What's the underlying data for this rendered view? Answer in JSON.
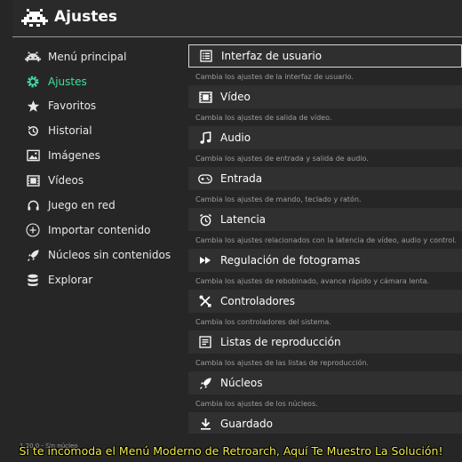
{
  "header": {
    "title": "Ajustes",
    "logo_icon": "retroarch-invader-icon"
  },
  "sidebar": {
    "items": [
      {
        "label": "Menú principal",
        "icon": "invader-icon",
        "active": false
      },
      {
        "label": "Ajustes",
        "icon": "gear-icon",
        "active": true
      },
      {
        "label": "Favoritos",
        "icon": "star-icon",
        "active": false
      },
      {
        "label": "Historial",
        "icon": "history-icon",
        "active": false
      },
      {
        "label": "Imágenes",
        "icon": "image-icon",
        "active": false
      },
      {
        "label": "Vídeos",
        "icon": "film-icon",
        "active": false
      },
      {
        "label": "Juego en red",
        "icon": "headset-icon",
        "active": false
      },
      {
        "label": "Importar contenido",
        "icon": "plus-circle-icon",
        "active": false
      },
      {
        "label": "Núcleos sin contenidos",
        "icon": "rocket-icon",
        "active": false
      },
      {
        "label": "Explorar",
        "icon": "database-icon",
        "active": false
      }
    ]
  },
  "settings": {
    "items": [
      {
        "label": "Interfaz de usuario",
        "desc": "Cambia los ajustes de la interfaz de usuario.",
        "icon": "menu-list-icon",
        "selected": true
      },
      {
        "label": "Vídeo",
        "desc": "Cambia los ajustes de salida de vídeo.",
        "icon": "film-icon",
        "selected": false
      },
      {
        "label": "Audio",
        "desc": "Cambia los ajustes de entrada y salida de audio.",
        "icon": "music-note-icon",
        "selected": false
      },
      {
        "label": "Entrada",
        "desc": "Cambia los ajustes de mando, teclado y ratón.",
        "icon": "gamepad-icon",
        "selected": false
      },
      {
        "label": "Latencia",
        "desc": "Cambia los ajustes relacionados con la latencia de vídeo, audio y control.",
        "icon": "alarm-clock-icon",
        "selected": false
      },
      {
        "label": "Regulación de fotogramas",
        "desc": "Cambia los ajustes de rebobinado, avance rápido y cámara lenta.",
        "icon": "fast-forward-icon",
        "selected": false
      },
      {
        "label": "Controladores",
        "desc": "Cambia los controladores del sistema.",
        "icon": "tools-icon",
        "selected": false
      },
      {
        "label": "Listas de reproducción",
        "desc": "Cambia los ajustes de las listas de reproducción.",
        "icon": "playlist-icon",
        "selected": false
      },
      {
        "label": "Núcleos",
        "desc": "Cambia los ajustes de los núcleos.",
        "icon": "rocket-icon",
        "selected": false
      },
      {
        "label": "Guardado",
        "desc": "",
        "icon": "download-icon",
        "selected": false
      }
    ]
  },
  "footer": {
    "status": "1.20.0 - Sin núcleo"
  },
  "caption": "Si te incomoda el Menú Moderno de Retroarch, Aquí Te Muestro La Solución!",
  "colors": {
    "accent": "#3fe0a0",
    "background": "#262626",
    "caption": "#f2ec4a"
  }
}
